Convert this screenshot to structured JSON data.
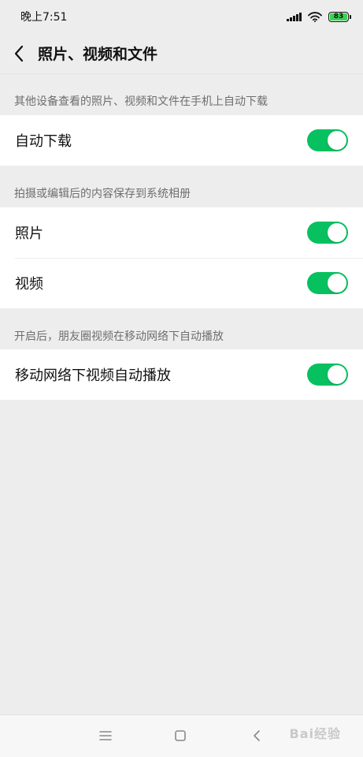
{
  "status_bar": {
    "time": "晚上7:51",
    "battery": "83"
  },
  "navbar": {
    "title": "照片、视频和文件"
  },
  "sections": [
    {
      "header": "其他设备查看的照片、视频和文件在手机上自动下载",
      "items": [
        {
          "label": "自动下载",
          "enabled": true
        }
      ]
    },
    {
      "header": "拍摄或编辑后的内容保存到系统相册",
      "items": [
        {
          "label": "照片",
          "enabled": true
        },
        {
          "label": "视频",
          "enabled": true
        }
      ]
    },
    {
      "header": "开启后，朋友圈视频在移动网络下自动播放",
      "items": [
        {
          "label": "移动网络下视频自动播放",
          "enabled": true
        }
      ]
    }
  ],
  "watermark": "Bai经验",
  "colors": {
    "toggle_on": "#07c160",
    "background": "#ededed",
    "battery_fill": "#39d353"
  }
}
